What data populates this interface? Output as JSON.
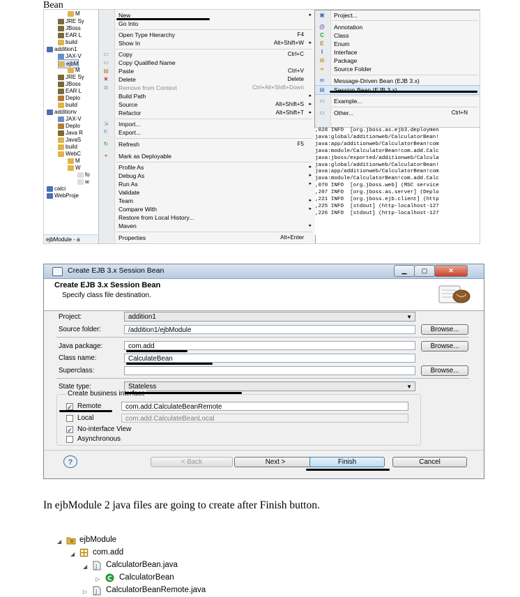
{
  "heading": "Bean",
  "tree": {
    "rows": [
      "M",
      "JRE Sy",
      "JBoss",
      "EAR L",
      "build",
      "addition1",
      "JAX-V",
      "ejbM",
      "M",
      "JRE Sy",
      "JBoss",
      "EAR L",
      "Deplo",
      "build",
      "additionv",
      "JAX-V",
      "Deplo",
      "Java R",
      "JavaS",
      "build",
      "WebC",
      "M",
      "W",
      "fo",
      "w",
      "calci",
      "WebProje"
    ],
    "status": "ejbModule - a"
  },
  "context_menu": {
    "items": [
      {
        "label": "New",
        "accel": "",
        "arrow": "▸",
        "disabled": false
      },
      {
        "label": "Go Into",
        "accel": "",
        "arrow": "",
        "disabled": false
      },
      {
        "label": "Open Type Hierarchy",
        "accel": "F4",
        "arrow": "",
        "disabled": false
      },
      {
        "label": "Show In",
        "accel": "Alt+Shift+W",
        "arrow": "▸",
        "disabled": false
      },
      {
        "label": "Copy",
        "accel": "Ctrl+C",
        "arrow": "",
        "disabled": false
      },
      {
        "label": "Copy Qualified Name",
        "accel": "",
        "arrow": "",
        "disabled": false
      },
      {
        "label": "Paste",
        "accel": "Ctrl+V",
        "arrow": "",
        "disabled": false
      },
      {
        "label": "Delete",
        "accel": "Delete",
        "arrow": "",
        "disabled": false
      },
      {
        "label": "Remove from Context",
        "accel": "Ctrl+Alt+Shift+Down",
        "arrow": "",
        "disabled": true
      },
      {
        "label": "Build Path",
        "accel": "",
        "arrow": "▸",
        "disabled": false
      },
      {
        "label": "Source",
        "accel": "Alt+Shift+S",
        "arrow": "▸",
        "disabled": false
      },
      {
        "label": "Refactor",
        "accel": "Alt+Shift+T",
        "arrow": "▸",
        "disabled": false
      },
      {
        "label": "Import...",
        "accel": "",
        "arrow": "",
        "disabled": false
      },
      {
        "label": "Export...",
        "accel": "",
        "arrow": "",
        "disabled": false
      },
      {
        "label": "Refresh",
        "accel": "F5",
        "arrow": "",
        "disabled": false
      },
      {
        "label": "Mark as Deployable",
        "accel": "",
        "arrow": "",
        "disabled": false
      },
      {
        "label": "Profile As",
        "accel": "",
        "arrow": "▸",
        "disabled": false
      },
      {
        "label": "Debug As",
        "accel": "",
        "arrow": "▸",
        "disabled": false
      },
      {
        "label": "Run As",
        "accel": "",
        "arrow": "▸",
        "disabled": false
      },
      {
        "label": "Validate",
        "accel": "",
        "arrow": "",
        "disabled": false
      },
      {
        "label": "Team",
        "accel": "",
        "arrow": "▸",
        "disabled": false
      },
      {
        "label": "Compare With",
        "accel": "",
        "arrow": "▸",
        "disabled": false
      },
      {
        "label": "Restore from Local History...",
        "accel": "",
        "arrow": "",
        "disabled": false
      },
      {
        "label": "Maven",
        "accel": "",
        "arrow": "▸",
        "disabled": false
      },
      {
        "label": "Properties",
        "accel": "Alt+Enter",
        "arrow": "",
        "disabled": false
      }
    ]
  },
  "submenu": {
    "items": [
      {
        "label": "Project...",
        "accel": ""
      },
      {
        "label": "Annotation",
        "accel": ""
      },
      {
        "label": "Class",
        "accel": ""
      },
      {
        "label": "Enum",
        "accel": ""
      },
      {
        "label": "Interface",
        "accel": ""
      },
      {
        "label": "Package",
        "accel": ""
      },
      {
        "label": "Source Folder",
        "accel": ""
      },
      {
        "label": "Message-Driven Bean (EJB 3.x)",
        "accel": ""
      },
      {
        "label": "Session Bean (EJB 3.x)",
        "accel": ""
      },
      {
        "label": "Example...",
        "accel": ""
      },
      {
        "label": "Other...",
        "accel": "Ctrl+N"
      }
    ]
  },
  "console": {
    "lines": [
      ",028 INFO  [org.jboss.as.ejb3.deploymen",
      "",
      "java:global/additionweb/CalculatorBean!",
      "java:app/additionweb/CalculatorBean!com",
      "java:module/CalculatorBean!com.add.Calc",
      "java:jboss/exported/additionweb/Calcula",
      "java:global/additionweb/CalculatorBean!",
      "java:app/additionweb/CalculatorBean!com",
      "java:module/CalculatorBean!com.add.Calc",
      "",
      ",070 INFO  [org.jboss.web] (MSC service",
      ",207 INFO  [org.jboss.as.server] (Deplo",
      ",221 INFO  [org.jboss.ejb.client] (http",
      ",225 INFO  [stdout] (http-localhost-127",
      "",
      ",226 INFO  [stdout] (http-localhost-127"
    ]
  },
  "dialog": {
    "title": "Create EJB 3.x Session Bean",
    "header_title": "Create EJB 3.x Session Bean",
    "header_desc": "Specify class file destination.",
    "project_label": "Project:",
    "project_value": "addition1",
    "source_folder_label": "Source folder:",
    "source_folder_value": "/addition1/ejbModule",
    "java_package_label": "Java package:",
    "java_package_value": "com.add",
    "class_name_label": "Class name:",
    "class_name_value": "CalculateBean",
    "superclass_label": "Superclass:",
    "superclass_value": "",
    "state_type_label": "State type:",
    "state_type_value": "Stateless",
    "business_interface_title": "Create business interface",
    "remote_label": "Remote",
    "remote_value": "com.add.CalculateBeanRemote",
    "local_label": "Local",
    "local_value": "com.add.CalculateBeanLocal",
    "no_interface_label": "No-interface View",
    "asynchronous_label": "Asynchronous",
    "browse_label": "Browse...",
    "back_label": "< Back",
    "next_label": "Next >",
    "finish_label": "Finish",
    "cancel_label": "Cancel",
    "help_glyph": "?",
    "remote_checked": true,
    "local_checked": false,
    "no_interface_checked": true,
    "asynchronous_checked": false
  },
  "paragraph": "In ejbModule 2 java files are going to create after Finish button.",
  "bottom_tree": {
    "root": "ejbModule",
    "package": "com.add",
    "file1": "CalculatorBean.java",
    "class1": "CalculatorBean",
    "file2": "CalculatorBeanRemote.java"
  },
  "colors": {
    "accent": "#3c7fb1",
    "folder": "#e3b24a",
    "class_icon": "#1f9c3b",
    "package_icon": "#b8860b"
  }
}
